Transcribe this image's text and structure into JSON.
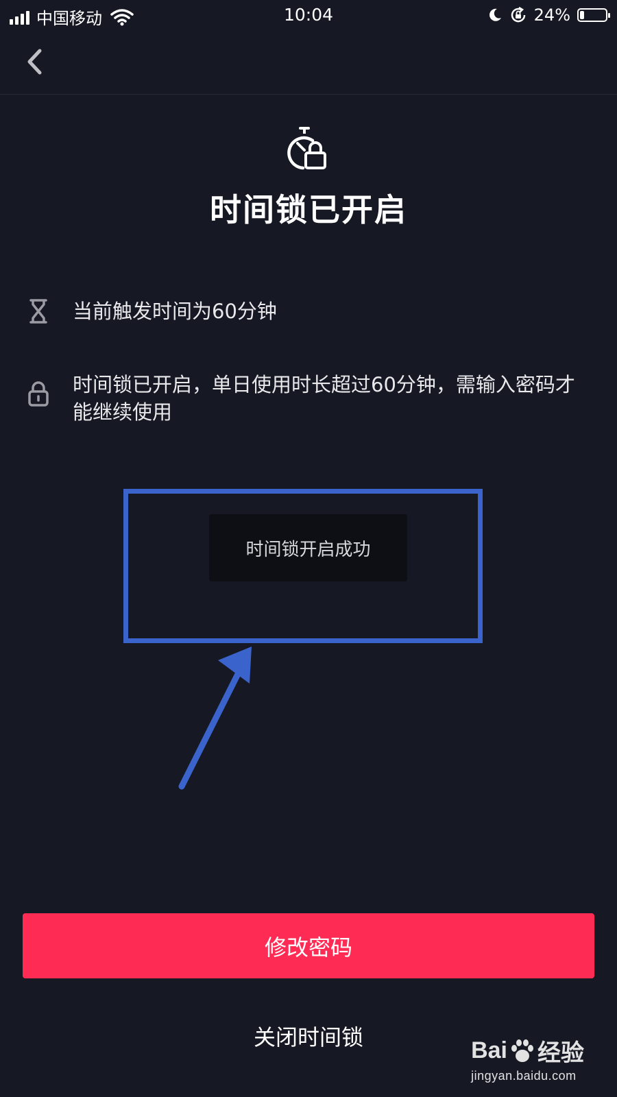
{
  "status_bar": {
    "carrier": "中国移动",
    "time": "10:04",
    "battery_percent": "24%",
    "battery_level": 0.24,
    "icons": [
      "signal-icon",
      "wifi-icon",
      "moon-icon",
      "rotation-lock-icon",
      "battery-icon"
    ]
  },
  "nav": {
    "back_icon": "chevron-left-icon"
  },
  "hero": {
    "icon": "timer-lock-icon",
    "title": "时间锁已开启"
  },
  "info": [
    {
      "icon": "hourglass-icon",
      "text": "当前触发时间为60分钟"
    },
    {
      "icon": "lock-icon",
      "text": "时间锁已开启，单日使用时长超过60分钟，需输入密码才能继续使用"
    }
  ],
  "toast": {
    "text": "时间锁开启成功"
  },
  "annotation": {
    "box_color": "#3b63cc",
    "arrow_color": "#3b63cc"
  },
  "actions": {
    "primary": "修改密码",
    "secondary": "关闭时间锁"
  },
  "watermark": {
    "brand": "Bai",
    "brand_suffix": "经验",
    "url": "jingyan.baidu.com"
  },
  "colors": {
    "background": "#161824",
    "accent": "#fe2c55"
  }
}
